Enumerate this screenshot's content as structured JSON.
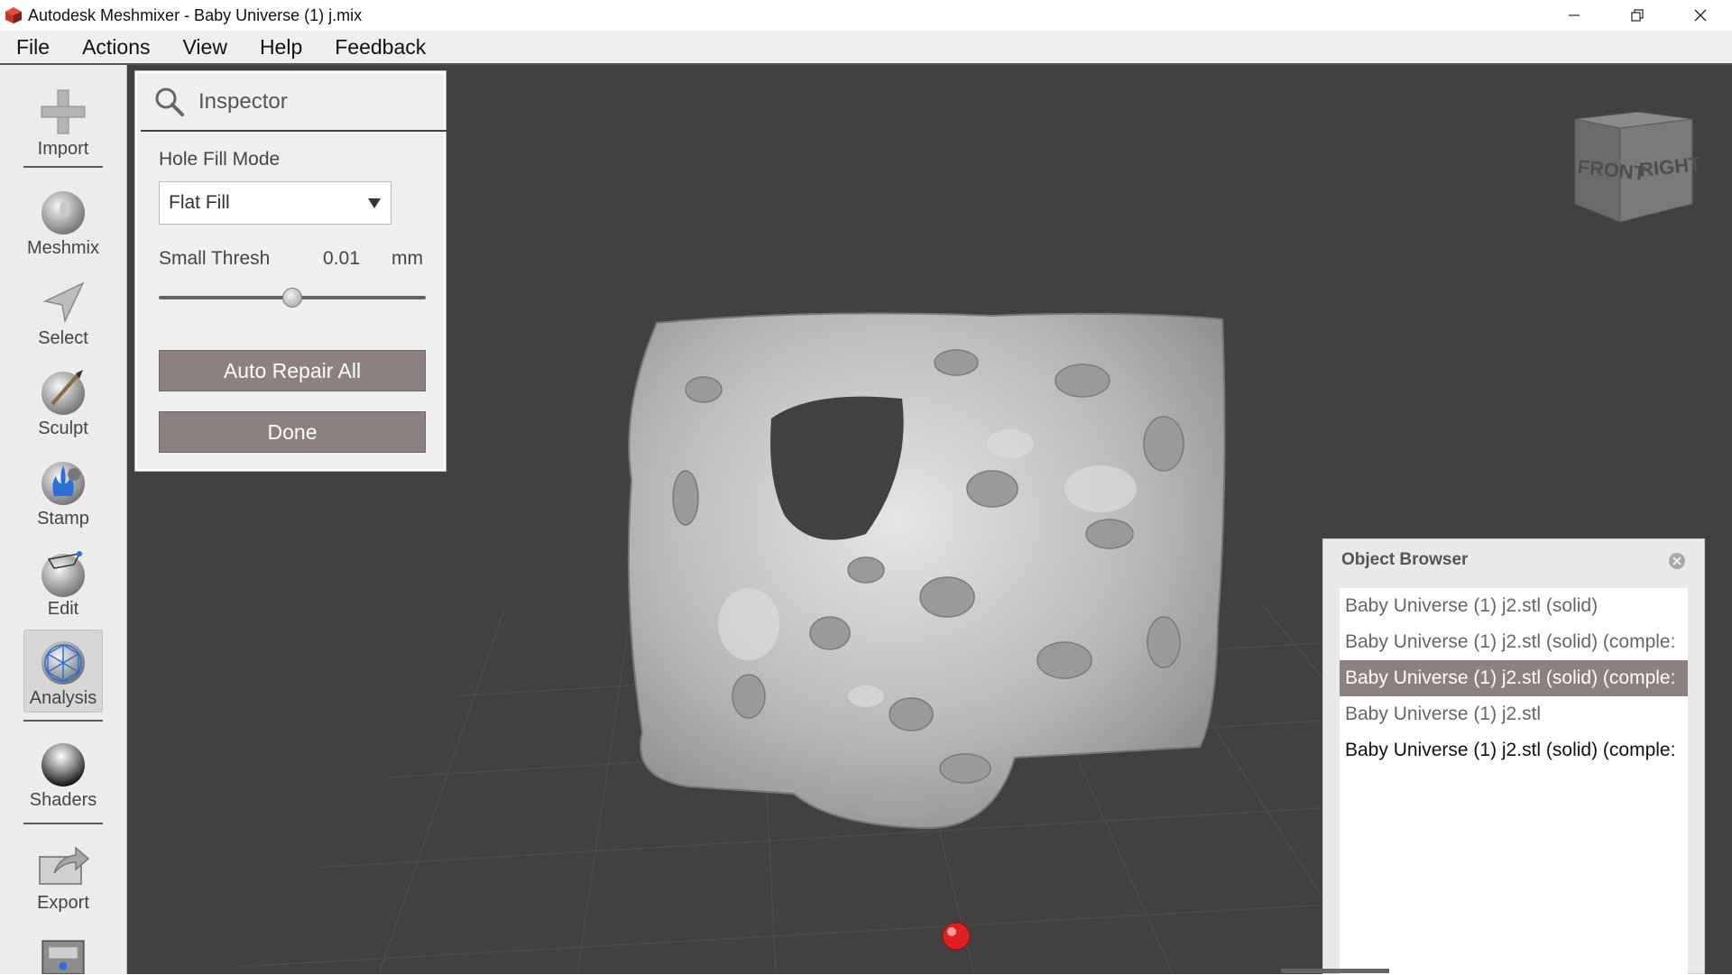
{
  "window": {
    "title": "Autodesk Meshmixer - Baby Universe (1) j.mix"
  },
  "menu": [
    "File",
    "Actions",
    "View",
    "Help",
    "Feedback"
  ],
  "toolbar": {
    "import": "Import",
    "meshmix": "Meshmix",
    "select": "Select",
    "sculpt": "Sculpt",
    "stamp": "Stamp",
    "edit": "Edit",
    "analysis": "Analysis",
    "shaders": "Shaders",
    "export": "Export"
  },
  "inspector": {
    "title": "Inspector",
    "hole_fill_mode_label": "Hole Fill Mode",
    "hole_fill_mode_value": "Flat Fill",
    "small_thresh_label": "Small Thresh",
    "small_thresh_value": "0.01",
    "small_thresh_unit": "mm",
    "small_thresh_slider_fraction": 0.5,
    "auto_repair_button": "Auto Repair All",
    "done_button": "Done"
  },
  "viewcube": {
    "front": "FRONT",
    "right": "RIGHT"
  },
  "object_browser": {
    "title": "Object Browser",
    "items": [
      {
        "label": "Baby Universe (1) j2.stl (solid)",
        "state": "normal"
      },
      {
        "label": "Baby Universe (1) j2.stl (solid) (comple:",
        "state": "normal"
      },
      {
        "label": "Baby Universe (1) j2.stl (solid) (comple:",
        "state": "selected"
      },
      {
        "label": "Baby Universe (1) j2.stl",
        "state": "normal"
      },
      {
        "label": "Baby Universe (1) j2.stl (solid) (comple:",
        "state": "active"
      }
    ]
  },
  "colors": {
    "viewport_bg": "#414141",
    "button_bg": "#8c8080",
    "mesh": "#c8c8c8",
    "pivot": "#e02020"
  }
}
